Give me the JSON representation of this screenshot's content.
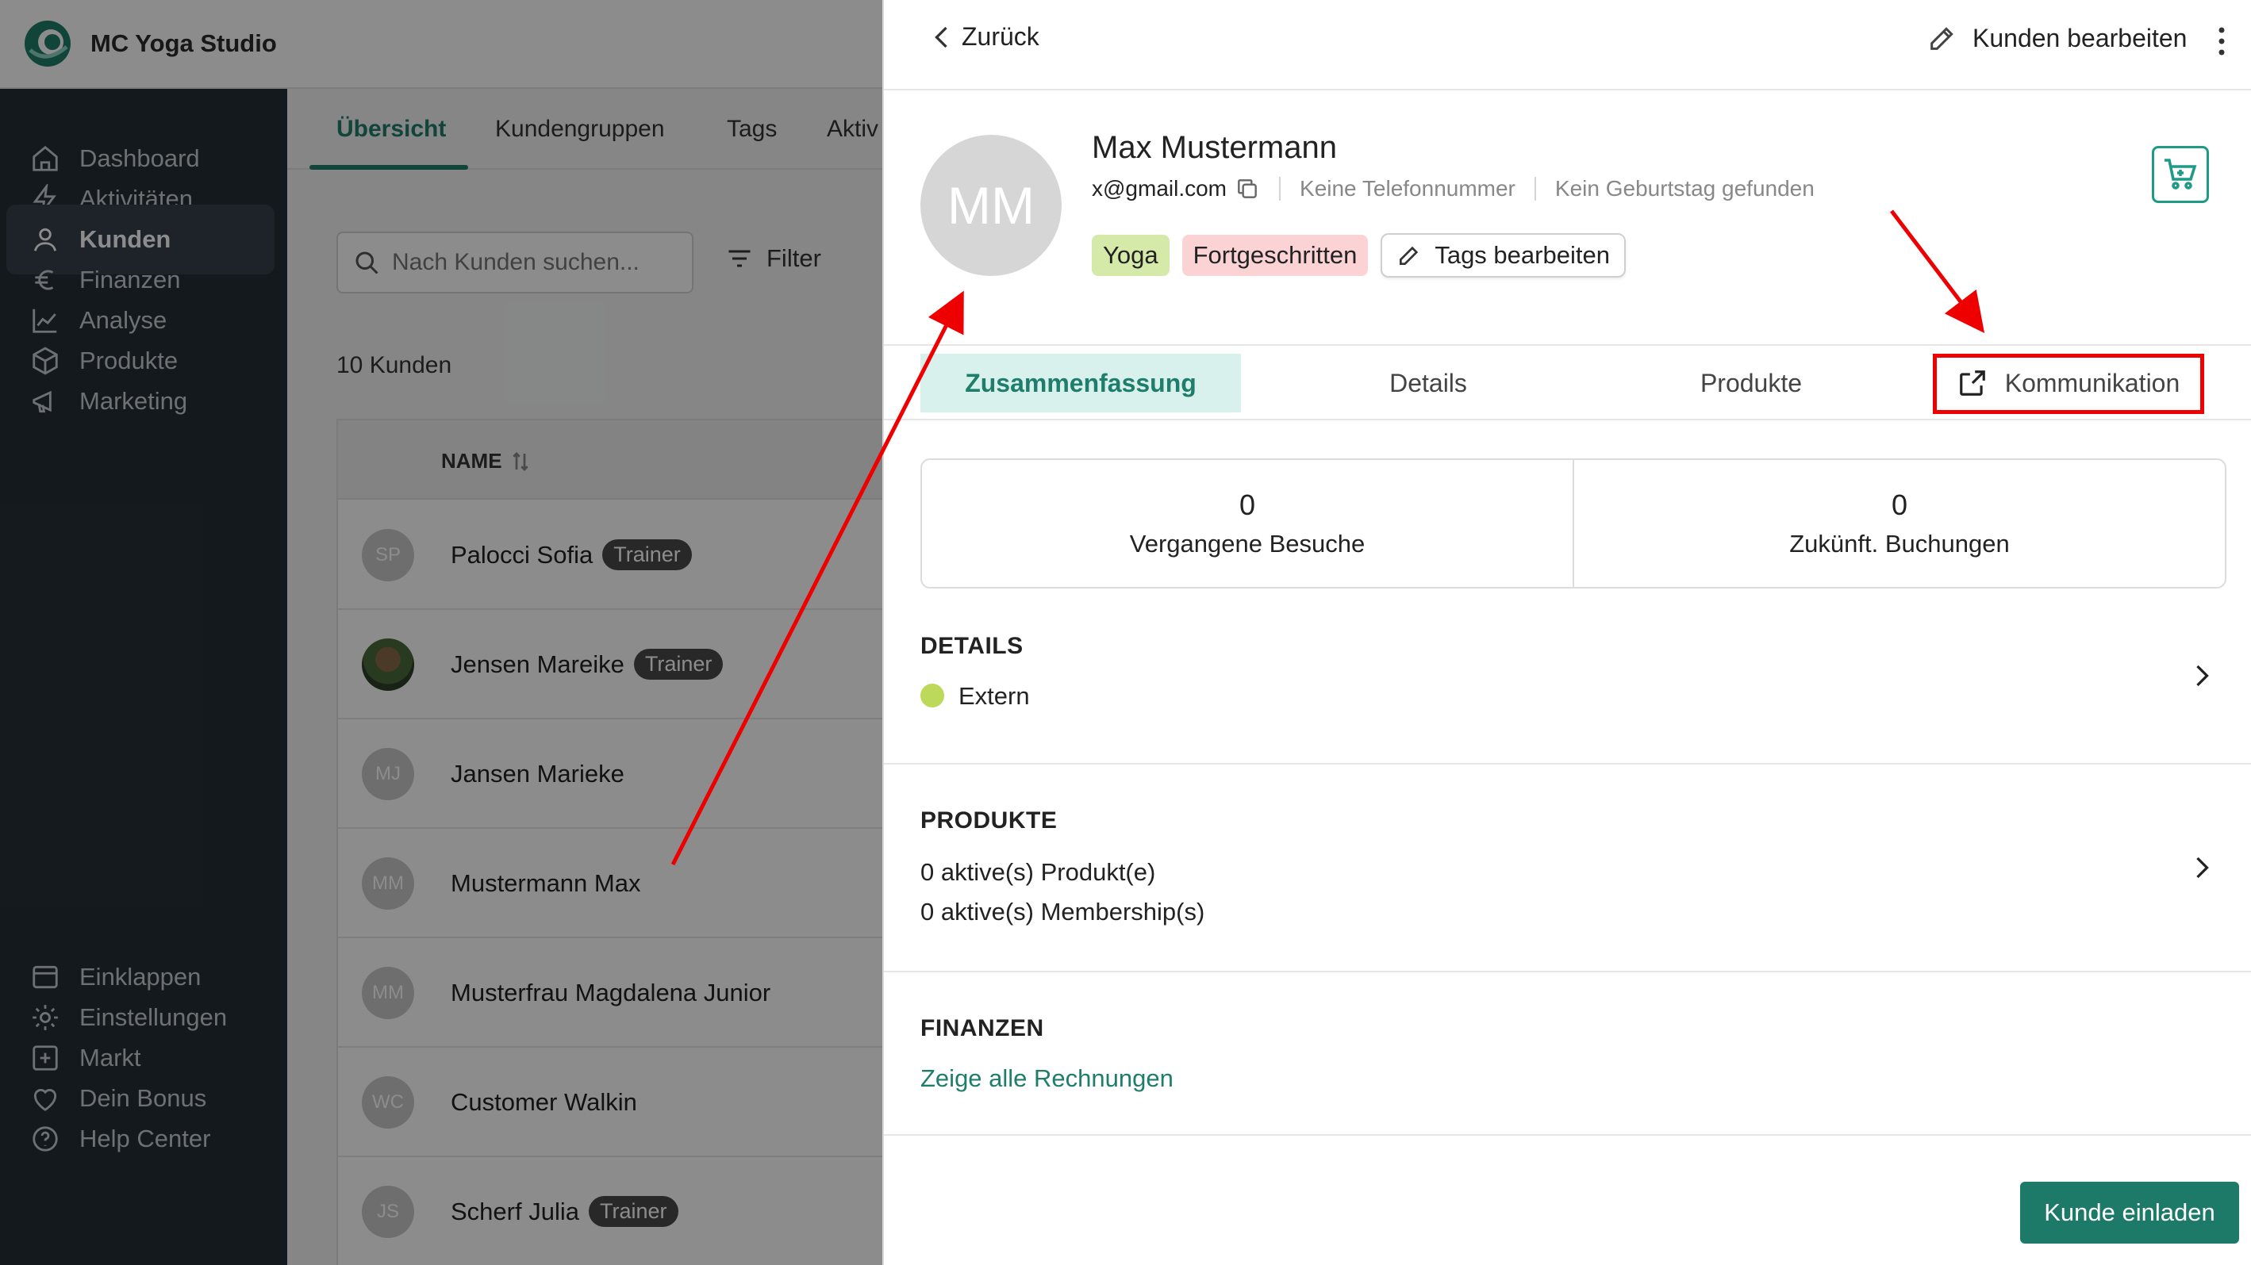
{
  "app": {
    "name": "MC Yoga Studio"
  },
  "sidebar": {
    "items": [
      {
        "label": "Dashboard",
        "icon": "home-icon"
      },
      {
        "label": "Aktivitäten",
        "icon": "bolt-icon"
      },
      {
        "label": "Kunden",
        "icon": "user-icon"
      },
      {
        "label": "Finanzen",
        "icon": "euro-icon"
      },
      {
        "label": "Analyse",
        "icon": "chart-icon"
      },
      {
        "label": "Produkte",
        "icon": "box-icon"
      },
      {
        "label": "Marketing",
        "icon": "megaphone-icon"
      }
    ],
    "bottom": [
      {
        "label": "Einklappen",
        "icon": "collapse-icon"
      },
      {
        "label": "Einstellungen",
        "icon": "gear-icon"
      },
      {
        "label": "Markt",
        "icon": "plus-square-icon"
      },
      {
        "label": "Dein Bonus",
        "icon": "heart-icon"
      },
      {
        "label": "Help Center",
        "icon": "help-icon"
      }
    ]
  },
  "main": {
    "tabs": [
      "Übersicht",
      "Kundengruppen",
      "Tags",
      "Aktiv"
    ],
    "search_placeholder": "Nach Kunden suchen...",
    "filter_label": "Filter",
    "count": "10 Kunden",
    "column_name": "NAME",
    "rows": [
      {
        "initials": "SP",
        "name": "Palocci Sofia",
        "badge": "Trainer"
      },
      {
        "initials": "",
        "name": "Jensen Mareike",
        "badge": "Trainer"
      },
      {
        "initials": "MJ",
        "name": "Jansen Marieke",
        "badge": ""
      },
      {
        "initials": "MM",
        "name": "Mustermann Max",
        "badge": ""
      },
      {
        "initials": "MM",
        "name": "Musterfrau Magdalena Junior",
        "badge": ""
      },
      {
        "initials": "WC",
        "name": "Customer Walkin",
        "badge": ""
      },
      {
        "initials": "JS",
        "name": "Scherf Julia",
        "badge": "Trainer"
      }
    ]
  },
  "drawer": {
    "back_label": "Zurück",
    "edit_label": "Kunden bearbeiten",
    "avatar_initials": "MM",
    "name": "Max Mustermann",
    "email": "x@gmail.com",
    "phone": "Keine Telefonnummer",
    "birthday": "Kein Geburtstag gefunden",
    "tags": [
      "Yoga",
      "Fortgeschritten"
    ],
    "tags_edit_label": "Tags bearbeiten",
    "tabs": [
      "Zusammenfassung",
      "Details",
      "Produkte",
      "Kommunikation"
    ],
    "stats": [
      {
        "value": "0",
        "label": "Vergangene Besuche"
      },
      {
        "value": "0",
        "label": "Zukünft. Buchungen"
      }
    ],
    "details": {
      "title": "DETAILS",
      "status": "Extern",
      "status_color": "#bcd95a"
    },
    "products": {
      "title": "PRODUKTE",
      "line1": "0 aktive(s) Produkt(e)",
      "line2": "0 aktive(s) Membership(s)"
    },
    "finance": {
      "title": "FINANZEN",
      "link": "Zeige alle Rechnungen"
    },
    "invite_label": "Kunde einladen"
  },
  "colors": {
    "accent": "#1f7e6b",
    "sidebar": "#262f36",
    "annotation": "#ef0000"
  }
}
